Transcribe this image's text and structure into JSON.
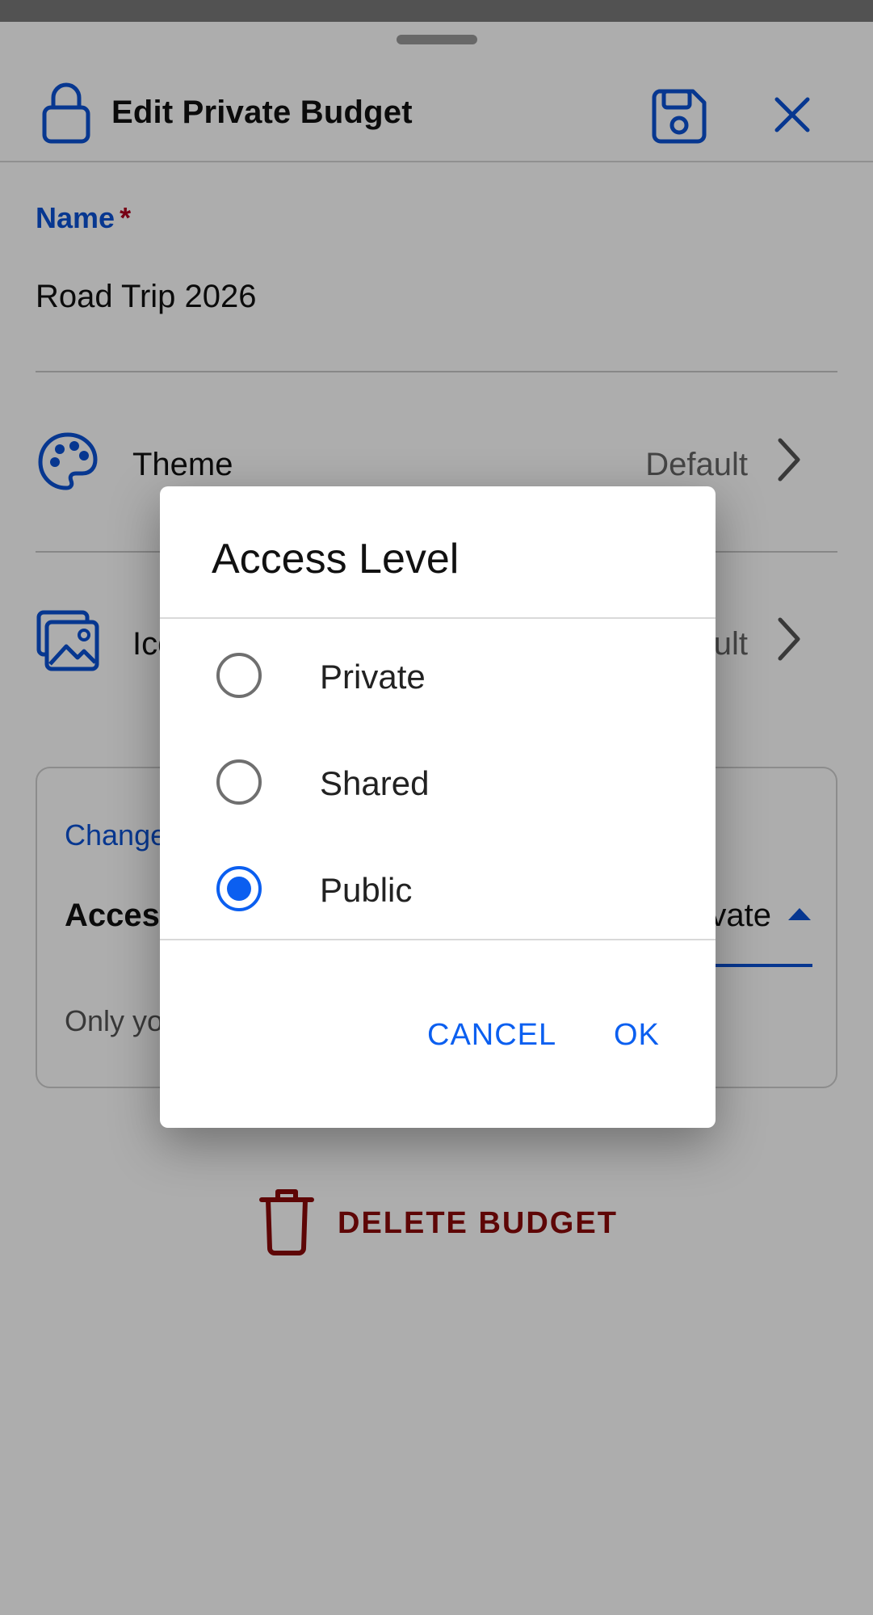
{
  "header": {
    "title": "Edit Private Budget"
  },
  "name_field": {
    "label": "Name",
    "required_mark": "*",
    "value": "Road Trip 2026"
  },
  "rows": [
    {
      "label": "Theme",
      "value": "Default"
    },
    {
      "label": "Icon",
      "value": "Default"
    }
  ],
  "access_card": {
    "title": "Change",
    "field_label": "Access Level",
    "field_value": "Private",
    "hint": "Only you"
  },
  "delete": {
    "label": "DELETE BUDGET"
  },
  "dialog": {
    "title": "Access Level",
    "options": [
      {
        "label": "Private",
        "selected": false
      },
      {
        "label": "Shared",
        "selected": false
      },
      {
        "label": "Public",
        "selected": true
      }
    ],
    "cancel_label": "CANCEL",
    "ok_label": "OK"
  },
  "colors": {
    "accent": "#0b52d4",
    "radio_selected": "#0b5ff0",
    "danger": "#8b0a0a",
    "required": "#b00020"
  },
  "icons": {
    "header_lock": "lock-icon",
    "save": "save-icon",
    "close": "close-icon",
    "theme": "palette-icon",
    "icon_row": "image-icon",
    "chevron": "chevron-right-icon",
    "caret": "caret-up-icon",
    "delete": "trash-icon"
  }
}
